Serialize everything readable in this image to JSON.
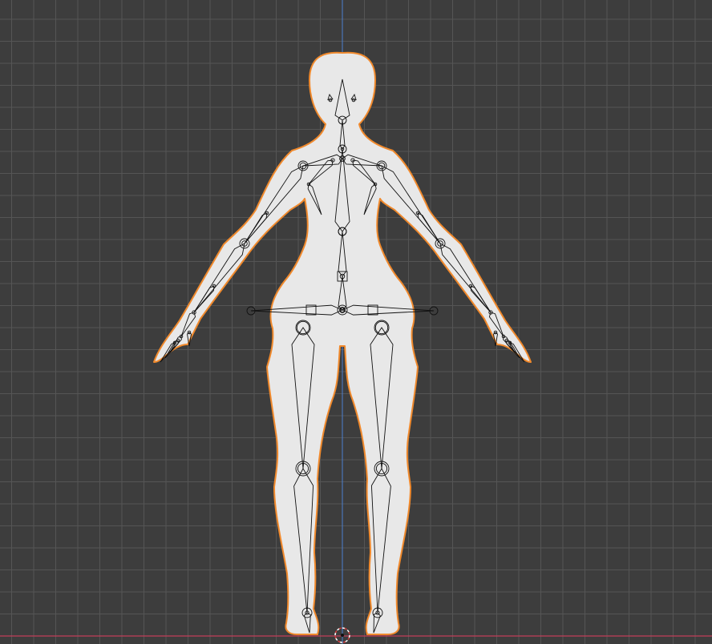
{
  "viewport": {
    "mode": "front-orthographic",
    "background_color": "#3d3d3d",
    "grid_minor_color": "#474747",
    "grid_major_color": "#555555",
    "axis_z_color": "#4c7fd0",
    "axis_x_color": "#c23e59",
    "grid": true
  },
  "mesh": {
    "name": "body-mesh",
    "fill_color": "#e8e8e8",
    "outline_color": "#f0892c",
    "selected": true
  },
  "armature": {
    "stroke_color": "#111111",
    "display": "octahedral"
  },
  "cursor": {
    "name": "3d-cursor",
    "ring_color_a": "#ffffff",
    "ring_color_b": "#d23c3c"
  }
}
